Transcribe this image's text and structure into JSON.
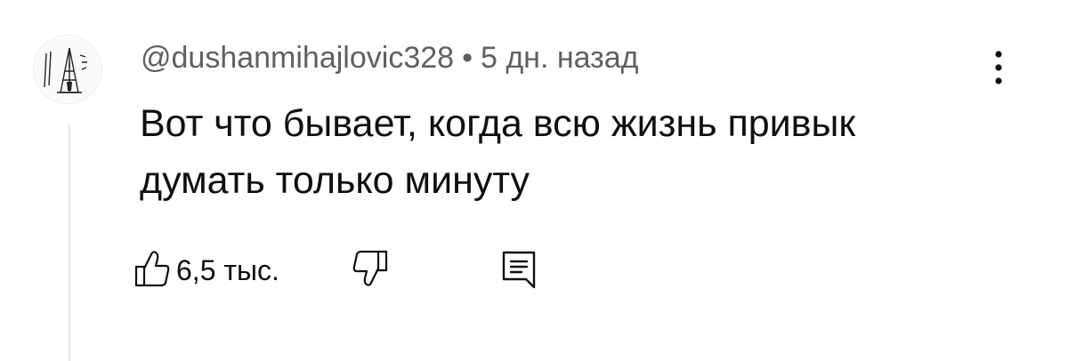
{
  "comment": {
    "author": "@dushanmihajlovic328",
    "separator": "•",
    "time": "5 дн. назад",
    "text_lines": [
      "Вот что бывает, когда всю жизнь привык",
      "думать только минуту"
    ],
    "likes": "6,5 тыс."
  },
  "icons": {
    "like": "thumb-up-icon",
    "dislike": "thumb-down-icon",
    "reply": "reply-comment-icon",
    "menu": "more-vertical-icon"
  },
  "colors": {
    "text": "#0f0f0f",
    "meta": "#606060",
    "thread_line": "#e5e5e5"
  }
}
